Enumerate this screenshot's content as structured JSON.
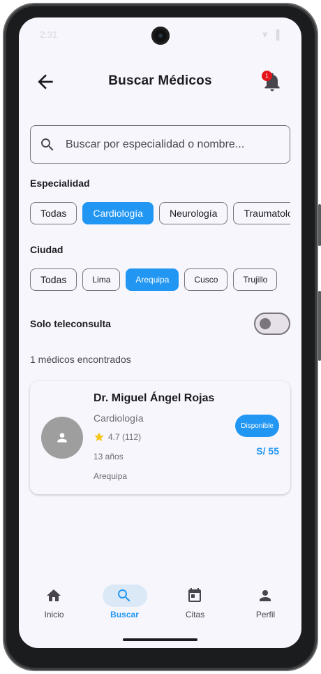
{
  "status_bar": {
    "time": "2:31",
    "icons": "▼ ▌"
  },
  "header": {
    "title": "Buscar Médicos",
    "notification_count": "1"
  },
  "search": {
    "placeholder": "Buscar por especialidad o nombre..."
  },
  "specialty": {
    "label": "Especialidad",
    "chips": [
      "Todas",
      "Cardiología",
      "Neurología",
      "Traumatolo"
    ],
    "selected": "Cardiología"
  },
  "city": {
    "label": "Ciudad",
    "chips": [
      "Todas",
      "Lima",
      "Arequipa",
      "Cusco",
      "Trujillo"
    ],
    "selected": "Arequipa"
  },
  "teleconsult": {
    "label": "Solo teleconsulta",
    "enabled": false
  },
  "results": {
    "count_text": "1 médicos encontrados",
    "doctors": [
      {
        "name": "Dr. Miguel Ángel Rojas",
        "specialty": "Cardiología",
        "rating": "4.7 (112)",
        "experience": "13 años",
        "city": "Arequipa",
        "availability": "Disponible",
        "price": "S/ 55"
      }
    ]
  },
  "nav": {
    "items": [
      {
        "label": "Inicio",
        "icon": "home-icon"
      },
      {
        "label": "Buscar",
        "icon": "search-icon"
      },
      {
        "label": "Citas",
        "icon": "calendar-icon"
      },
      {
        "label": "Perfil",
        "icon": "person-icon"
      }
    ],
    "active": "Buscar"
  },
  "colors": {
    "accent": "#2196f3",
    "background": "#f7f6fc",
    "badge": "#e5141a",
    "star": "#f5c518"
  }
}
